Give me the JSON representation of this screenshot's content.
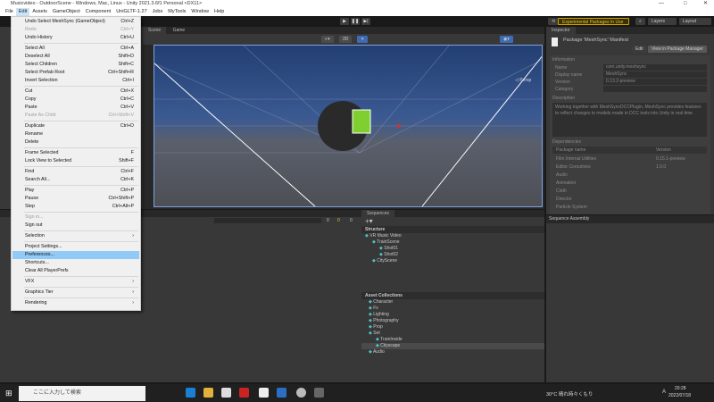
{
  "window": {
    "title": "Musicvideo - OutdoorScene - Windows, Mac, Linux - Unity 2021.3.6f1 Personal <DX11>"
  },
  "menubar": [
    "File",
    "Edit",
    "Assets",
    "GameObject",
    "Component",
    "UniGLTF-1.27",
    "Jobs",
    "MyTools",
    "Window",
    "Help"
  ],
  "toolbar": {
    "experimental": "Experimental Packages In Use ▾",
    "layers": "Layers",
    "layout": "Layout"
  },
  "edit_menu": [
    {
      "label": "Undo Select MeshSync (GameObject)",
      "shortcut": "Ctrl+Z"
    },
    {
      "label": "Redo",
      "shortcut": "Ctrl+Y",
      "disabled": true
    },
    {
      "label": "Undo History",
      "shortcut": "Ctrl+U"
    },
    {
      "sep": true
    },
    {
      "label": "Select All",
      "shortcut": "Ctrl+A"
    },
    {
      "label": "Deselect All",
      "shortcut": "Shift+D"
    },
    {
      "label": "Select Children",
      "shortcut": "Shift+C"
    },
    {
      "label": "Select Prefab Root",
      "shortcut": "Ctrl+Shift+R"
    },
    {
      "label": "Invert Selection",
      "shortcut": "Ctrl+I"
    },
    {
      "sep": true
    },
    {
      "label": "Cut",
      "shortcut": "Ctrl+X"
    },
    {
      "label": "Copy",
      "shortcut": "Ctrl+C"
    },
    {
      "label": "Paste",
      "shortcut": "Ctrl+V"
    },
    {
      "label": "Paste As Child",
      "shortcut": "Ctrl+Shift+V",
      "disabled": true
    },
    {
      "sep": true
    },
    {
      "label": "Duplicate",
      "shortcut": "Ctrl+D"
    },
    {
      "label": "Rename",
      "shortcut": ""
    },
    {
      "label": "Delete",
      "shortcut": ""
    },
    {
      "sep": true
    },
    {
      "label": "Frame Selected",
      "shortcut": "F"
    },
    {
      "label": "Lock View to Selected",
      "shortcut": "Shift+F"
    },
    {
      "sep": true
    },
    {
      "label": "Find",
      "shortcut": "Ctrl+F"
    },
    {
      "label": "Search All...",
      "shortcut": "Ctrl+K"
    },
    {
      "sep": true
    },
    {
      "label": "Play",
      "shortcut": "Ctrl+P"
    },
    {
      "label": "Pause",
      "shortcut": "Ctrl+Shift+P"
    },
    {
      "label": "Step",
      "shortcut": "Ctrl+Alt+P"
    },
    {
      "sep": true
    },
    {
      "label": "Sign in...",
      "shortcut": "",
      "disabled": true
    },
    {
      "label": "Sign out",
      "shortcut": ""
    },
    {
      "sep": true
    },
    {
      "label": "Selection",
      "shortcut": "›"
    },
    {
      "sep": true
    },
    {
      "label": "Project Settings...",
      "shortcut": ""
    },
    {
      "label": "Preferences...",
      "shortcut": "",
      "highlighted": true
    },
    {
      "label": "Shortcuts...",
      "shortcut": ""
    },
    {
      "label": "Clear All PlayerPrefs",
      "shortcut": ""
    },
    {
      "sep": true
    },
    {
      "label": "VFX",
      "shortcut": "›"
    },
    {
      "sep": true
    },
    {
      "label": "Graphics Tier",
      "shortcut": "›"
    },
    {
      "sep": true
    },
    {
      "label": "Rendering",
      "shortcut": "›"
    }
  ],
  "scene": {
    "tabs": [
      "Scene",
      "Game"
    ],
    "mode_2d": "2D",
    "persp": "◁ Persp"
  },
  "inspector": {
    "tab": "Inspector",
    "title": "Package 'MeshSync' Manifest",
    "edit": "Edit",
    "view_pm": "View in Package Manager",
    "information": "Information",
    "fields": [
      {
        "label": "Name",
        "value": "com.unity.meshsync"
      },
      {
        "label": "Display name",
        "value": "MeshSync"
      },
      {
        "label": "Version",
        "value": "0.13.2-preview"
      },
      {
        "label": "Category",
        "value": ""
      }
    ],
    "description_label": "Description",
    "description": "Working together with MeshSyncDCCPlugin, MeshSync provides features to reflect changes to models made in DCC tools into Unity in real time",
    "dependencies_label": "Dependencies",
    "dep_headers": [
      "Package name",
      "Version"
    ],
    "deps": [
      {
        "name": "Film Internal Utilities",
        "version": "0.15.1-preview"
      },
      {
        "name": "Editor Coroutines",
        "version": "1.0.0"
      },
      {
        "name": "Audio",
        "version": ""
      },
      {
        "name": "Animation",
        "version": ""
      },
      {
        "name": "Cloth",
        "version": ""
      },
      {
        "name": "Director",
        "version": ""
      },
      {
        "name": "Particle System",
        "version": ""
      }
    ]
  },
  "sequence_assembly": "Sequence Assembly",
  "console": {
    "counts": [
      "0",
      "0",
      "0"
    ]
  },
  "sequences": {
    "tab": "Sequences",
    "structure": "Structure",
    "tree": [
      {
        "label": "VR Music Video",
        "depth": 0
      },
      {
        "label": "TrainScene",
        "depth": 1
      },
      {
        "label": "Shot01",
        "depth": 2
      },
      {
        "label": "Shot02",
        "depth": 2
      },
      {
        "label": "CityScene",
        "depth": 1
      }
    ],
    "assets_label": "Asset Collections",
    "assets": [
      {
        "label": "Character",
        "depth": 0
      },
      {
        "label": "Fx",
        "depth": 0
      },
      {
        "label": "Lighting",
        "depth": 0
      },
      {
        "label": "Photography",
        "depth": 0
      },
      {
        "label": "Prop",
        "depth": 0
      },
      {
        "label": "Set",
        "depth": 0
      },
      {
        "label": "TrainInside",
        "depth": 1
      },
      {
        "label": "Cityscape",
        "depth": 1,
        "selected": true
      },
      {
        "label": "Audio",
        "depth": 0
      }
    ]
  },
  "taskbar": {
    "search": "ここに入力して検索",
    "weather": "30°C  晴れ時々くもり",
    "time": "20:28",
    "date": "2022/07/18",
    "ime": "A"
  }
}
